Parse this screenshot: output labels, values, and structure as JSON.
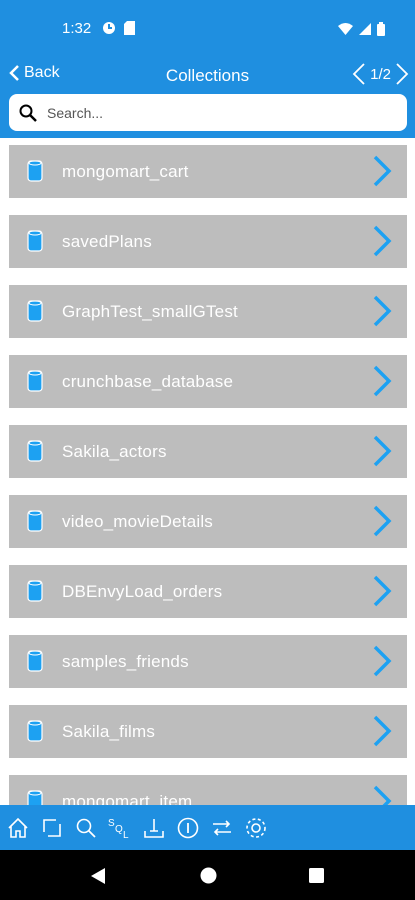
{
  "status_bar": {
    "time": "1:32"
  },
  "nav": {
    "back_label": "Back",
    "title": "Collections",
    "page_indicator": "1/2"
  },
  "search": {
    "placeholder": "Search..."
  },
  "collections": [
    {
      "label": "mongomart_cart"
    },
    {
      "label": "savedPlans"
    },
    {
      "label": "GraphTest_smallGTest"
    },
    {
      "label": "crunchbase_database"
    },
    {
      "label": "Sakila_actors"
    },
    {
      "label": "video_movieDetails"
    },
    {
      "label": "DBEnvyLoad_orders"
    },
    {
      "label": "samples_friends"
    },
    {
      "label": "Sakila_films"
    },
    {
      "label": "mongomart_item"
    }
  ],
  "toolbar": {
    "icons": [
      "home-icon",
      "sync-icon",
      "search-icon",
      "sql-icon",
      "import-icon",
      "info-icon",
      "sort-icon",
      "settings-icon"
    ],
    "sql_label": "SQL"
  },
  "colors": {
    "accent": "#1f8fe0",
    "item_bg": "#bdbdbd",
    "icon_blue": "#1da1f2"
  }
}
